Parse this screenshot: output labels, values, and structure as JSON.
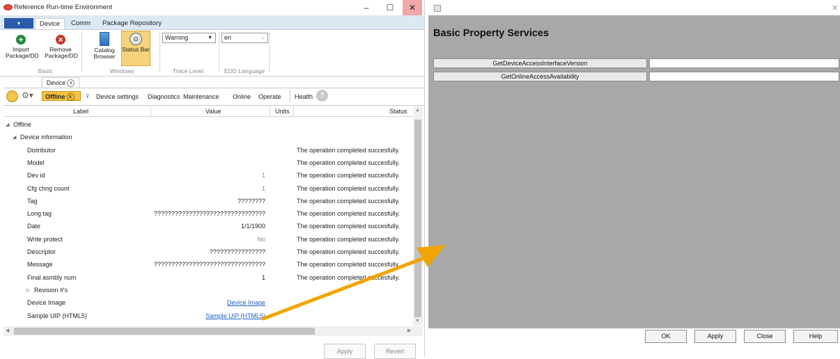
{
  "left_window": {
    "title": "Reference Run-time Environment",
    "controls": {
      "minimize": "–",
      "maximize": "☐",
      "close": "✕"
    },
    "ribbon_tabs": [
      "Device",
      "Comm",
      "Package Repository"
    ],
    "file_tab": "▾",
    "ribbon": {
      "import_label": "Import Package/DD",
      "remove_label": "Remove Package/DD",
      "basic_group": "Basic",
      "catalog_label": "Catalog Browser",
      "status_label": "Status Bar",
      "windows_group": "Windows",
      "trace_value": "Warning",
      "trace_group": "Trace Level",
      "lang_value": "en",
      "lang_group": "EDD Language"
    },
    "doc_tab": "Device",
    "toolbar": {
      "offline": "Offline",
      "items": [
        "Device settings",
        "Diagnostics",
        "Maintenance",
        "Online",
        "Operate",
        "Health"
      ],
      "health_badge": "?"
    },
    "grid": {
      "headers": {
        "label": "Label",
        "value": "Value",
        "units": "Units",
        "status": "Status"
      },
      "rows": [
        {
          "indent": 0,
          "arrow": "◢",
          "label": "Offline",
          "value": "",
          "style": "",
          "status": ""
        },
        {
          "indent": 1,
          "arrow": "◢",
          "label": "Device information",
          "value": "",
          "style": "",
          "status": ""
        },
        {
          "indent": 2,
          "arrow": "",
          "label": "Distributor",
          "value": "",
          "style": "",
          "status": "The operation completed succesfully."
        },
        {
          "indent": 2,
          "arrow": "",
          "label": "Model",
          "value": "",
          "style": "",
          "status": "The operation completed succesfully."
        },
        {
          "indent": 2,
          "arrow": "",
          "label": "Dev id",
          "value": "1",
          "style": "grey",
          "status": "The operation completed succesfully."
        },
        {
          "indent": 2,
          "arrow": "",
          "label": "Cfg chng count",
          "value": "1",
          "style": "grey",
          "status": "The operation completed succesfully."
        },
        {
          "indent": 2,
          "arrow": "",
          "label": "Tag",
          "value": "????????",
          "style": "",
          "status": "The operation completed succesfully."
        },
        {
          "indent": 2,
          "arrow": "",
          "label": "Long tag",
          "value": "????????????????????????????????",
          "style": "",
          "status": "The operation completed succesfully."
        },
        {
          "indent": 2,
          "arrow": "",
          "label": "Date",
          "value": "1/1/1900",
          "style": "",
          "status": "The operation completed succesfully."
        },
        {
          "indent": 2,
          "arrow": "",
          "label": "Write protect",
          "value": "No",
          "style": "grey",
          "status": "The operation completed succesfully."
        },
        {
          "indent": 2,
          "arrow": "",
          "label": "Descriptor",
          "value": "????????????????",
          "style": "",
          "status": "The operation completed succesfully."
        },
        {
          "indent": 2,
          "arrow": "",
          "label": "Message",
          "value": "????????????????????????????????",
          "style": "",
          "status": "The operation completed succesfully."
        },
        {
          "indent": 2,
          "arrow": "",
          "label": "Final asmbly num",
          "value": "1",
          "style": "",
          "status": "The operation completed succesfully."
        },
        {
          "indent": 2,
          "arrow": "▷",
          "label": "Revision #'s",
          "value": "",
          "style": "",
          "status": ""
        },
        {
          "indent": 2,
          "arrow": "",
          "label": "Device Image",
          "value": "Device Image",
          "style": "link",
          "status": ""
        },
        {
          "indent": 2,
          "arrow": "",
          "label": "Sample UIP (HTML5)",
          "value": "Sample UIP (HTML5)",
          "style": "link",
          "status": ""
        }
      ]
    },
    "apply_label": "Apply",
    "revert_label": "Revert"
  },
  "dialog": {
    "title": "Basic Property Services",
    "close_glyph": "✕",
    "services": [
      {
        "label": "GetDeviceAccessInterfaceVersion",
        "value": ""
      },
      {
        "label": "GetOnlineAccessAvailability",
        "value": ""
      }
    ],
    "buttons": {
      "ok": "OK",
      "apply": "Apply",
      "close": "Close",
      "help": "Help"
    }
  },
  "colors": {
    "arrow": "#f0a500",
    "offline_badge": "#f5c242",
    "dialog_body": "#a8a8a8",
    "file_tab": "#2a5ba8"
  }
}
